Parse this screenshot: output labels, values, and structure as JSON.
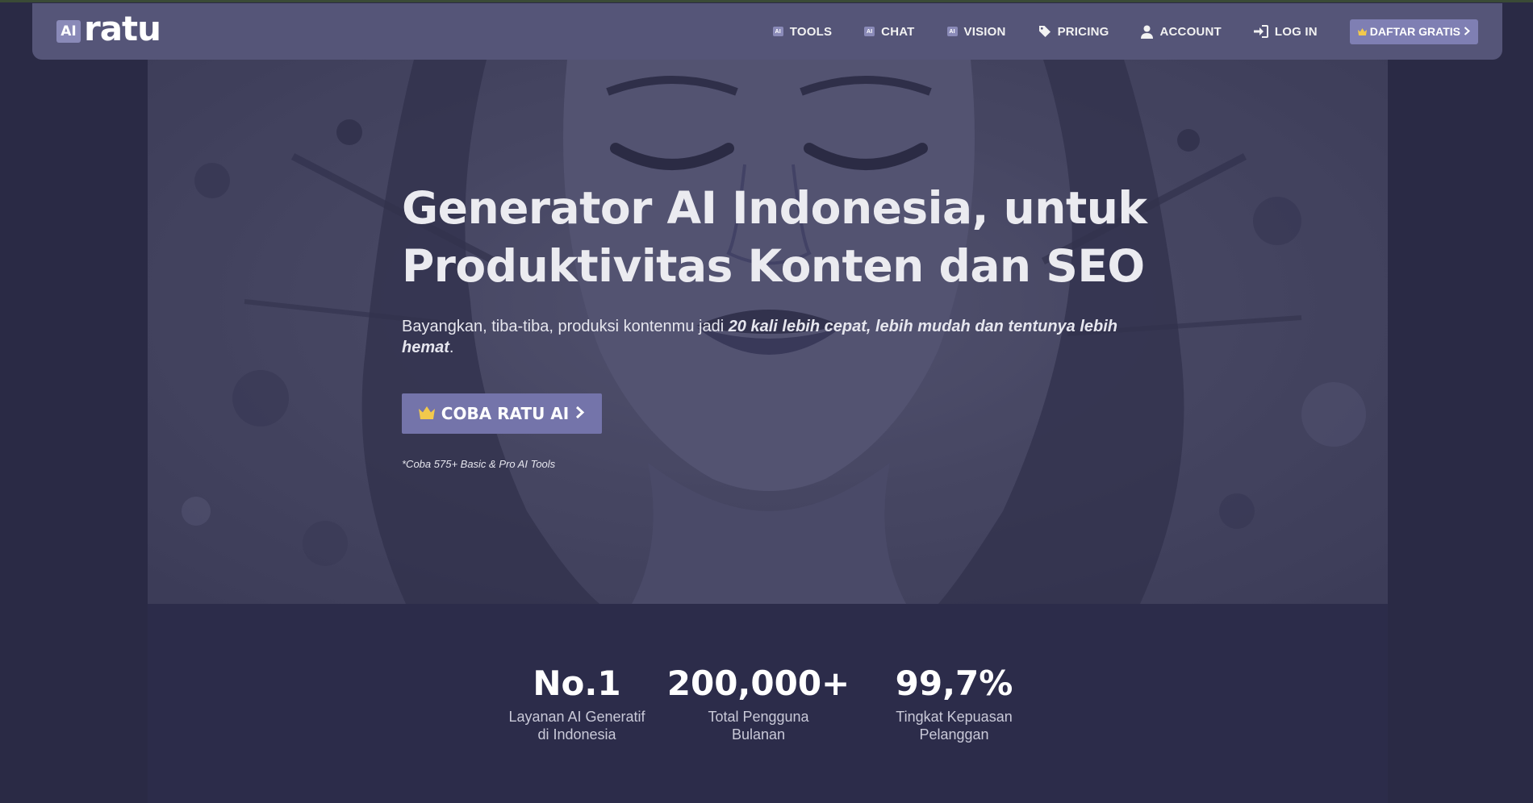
{
  "brand": {
    "badge": "AI",
    "name": "ratu"
  },
  "nav": {
    "tools": "TOOLS",
    "chat": "CHAT",
    "vision": "VISION",
    "pricing": "PRICING",
    "account": "ACCOUNT",
    "login": "LOG IN",
    "signup": "DAFTAR GRATIS",
    "ai_badge": "AI"
  },
  "hero": {
    "title_line1": "Generator AI Indonesia, untuk",
    "title_line2": "Produktivitas Konten dan SEO",
    "sub_plain": "Bayangkan, tiba-tiba, produksi kontenmu jadi ",
    "sub_emphasis": "20 kali lebih cepat, lebih mudah dan tentunya lebih hemat",
    "sub_end": ".",
    "button": "COBA RATU AI",
    "note": "*Coba 575+ Basic & Pro AI Tools"
  },
  "stats": [
    {
      "value": "No.1",
      "label_line1": "Layanan AI Generatif",
      "label_line2": "di Indonesia"
    },
    {
      "value": "200,000+",
      "label_line1": "Total Pengguna",
      "label_line2": "Bulanan"
    },
    {
      "value": "99,7%",
      "label_line1": "Tingkat Kepuasan",
      "label_line2": "Pelanggan"
    }
  ],
  "colors": {
    "page_bg": "#2a2a45",
    "navbar_bg": "#555578",
    "accent": "#7474aa",
    "crown": "#f2c94c"
  },
  "icons": {
    "crown": "crown-icon",
    "chevron": "chevron-right-icon",
    "tag": "tag-icon",
    "user": "user-icon",
    "login": "sign-in-icon"
  }
}
